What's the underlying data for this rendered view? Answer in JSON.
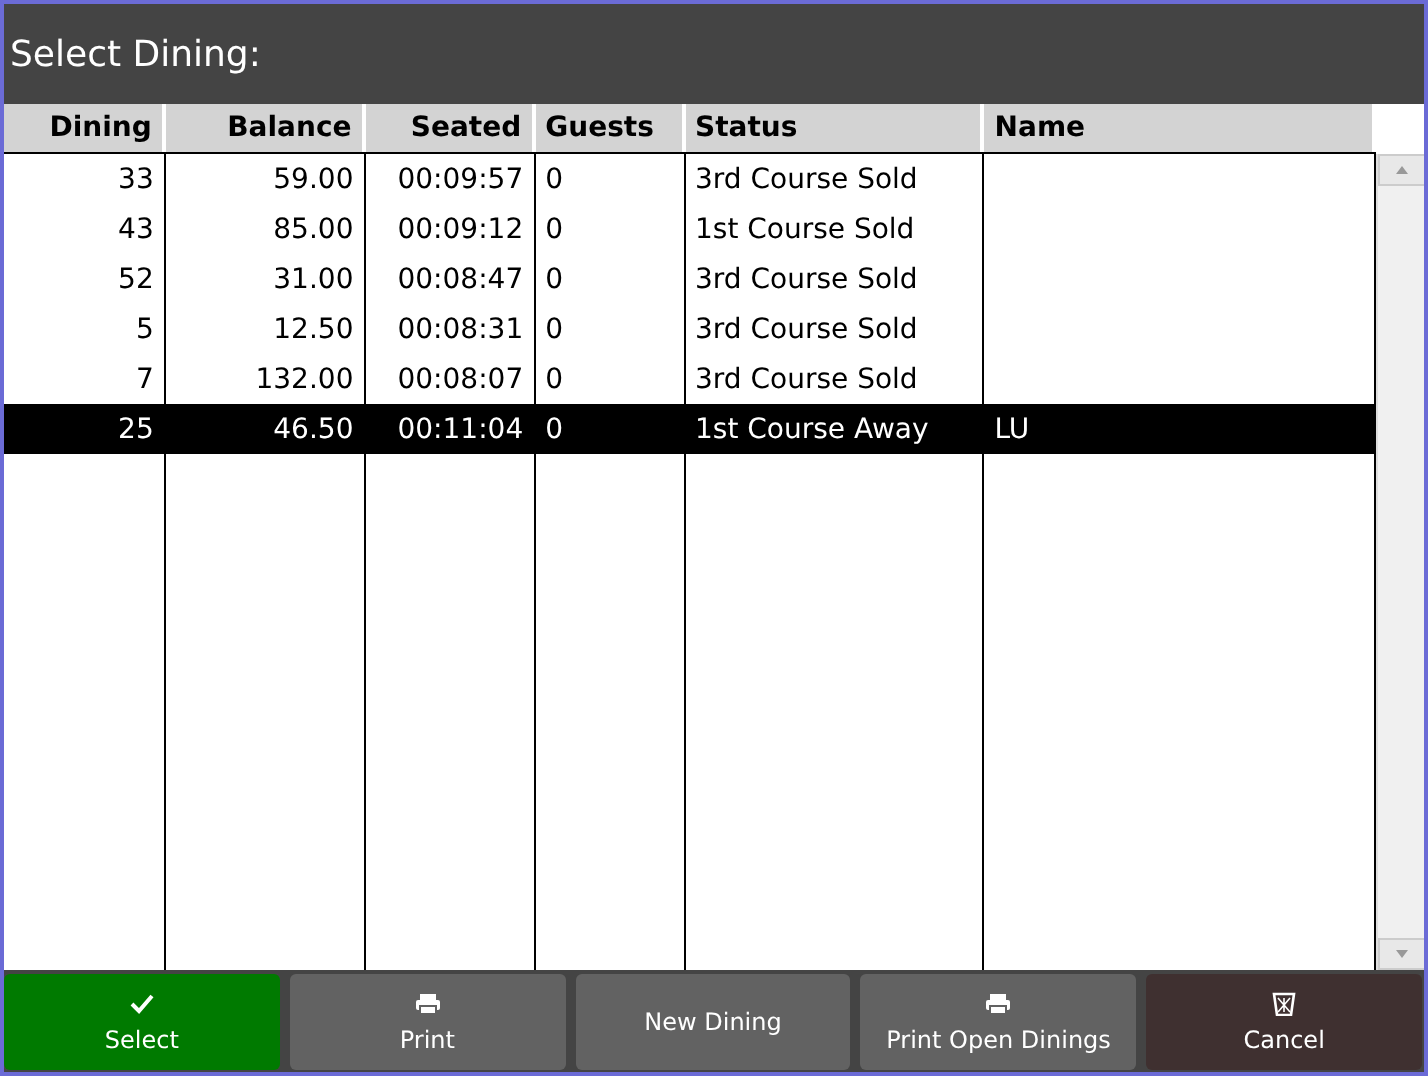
{
  "window": {
    "title": "Select Dining:"
  },
  "table": {
    "columns": [
      "Dining",
      "Balance",
      "Seated",
      "Guests",
      "Status",
      "Name"
    ],
    "rows": [
      {
        "cells": [
          "33",
          "59.00",
          "00:09:57",
          "0",
          "3rd Course Sold",
          ""
        ],
        "selected": false
      },
      {
        "cells": [
          "43",
          "85.00",
          "00:09:12",
          "0",
          "1st Course Sold",
          ""
        ],
        "selected": false
      },
      {
        "cells": [
          "52",
          "31.00",
          "00:08:47",
          "0",
          "3rd Course Sold",
          ""
        ],
        "selected": false
      },
      {
        "cells": [
          "5",
          "12.50",
          "00:08:31",
          "0",
          "3rd Course Sold",
          ""
        ],
        "selected": false
      },
      {
        "cells": [
          "7",
          "132.00",
          "00:08:07",
          "0",
          "3rd Course Sold",
          ""
        ],
        "selected": false
      },
      {
        "cells": [
          "25",
          "46.50",
          "00:11:04",
          "0",
          "1st Course Away",
          "LU"
        ],
        "selected": true
      }
    ]
  },
  "buttons": [
    {
      "label": "Select",
      "kind": "confirm"
    },
    {
      "label": "Print",
      "kind": "print"
    },
    {
      "label": "New Dining",
      "kind": "plain"
    },
    {
      "label": "Print Open Dinings",
      "kind": "print"
    },
    {
      "label": "Cancel",
      "kind": "cancel"
    }
  ]
}
